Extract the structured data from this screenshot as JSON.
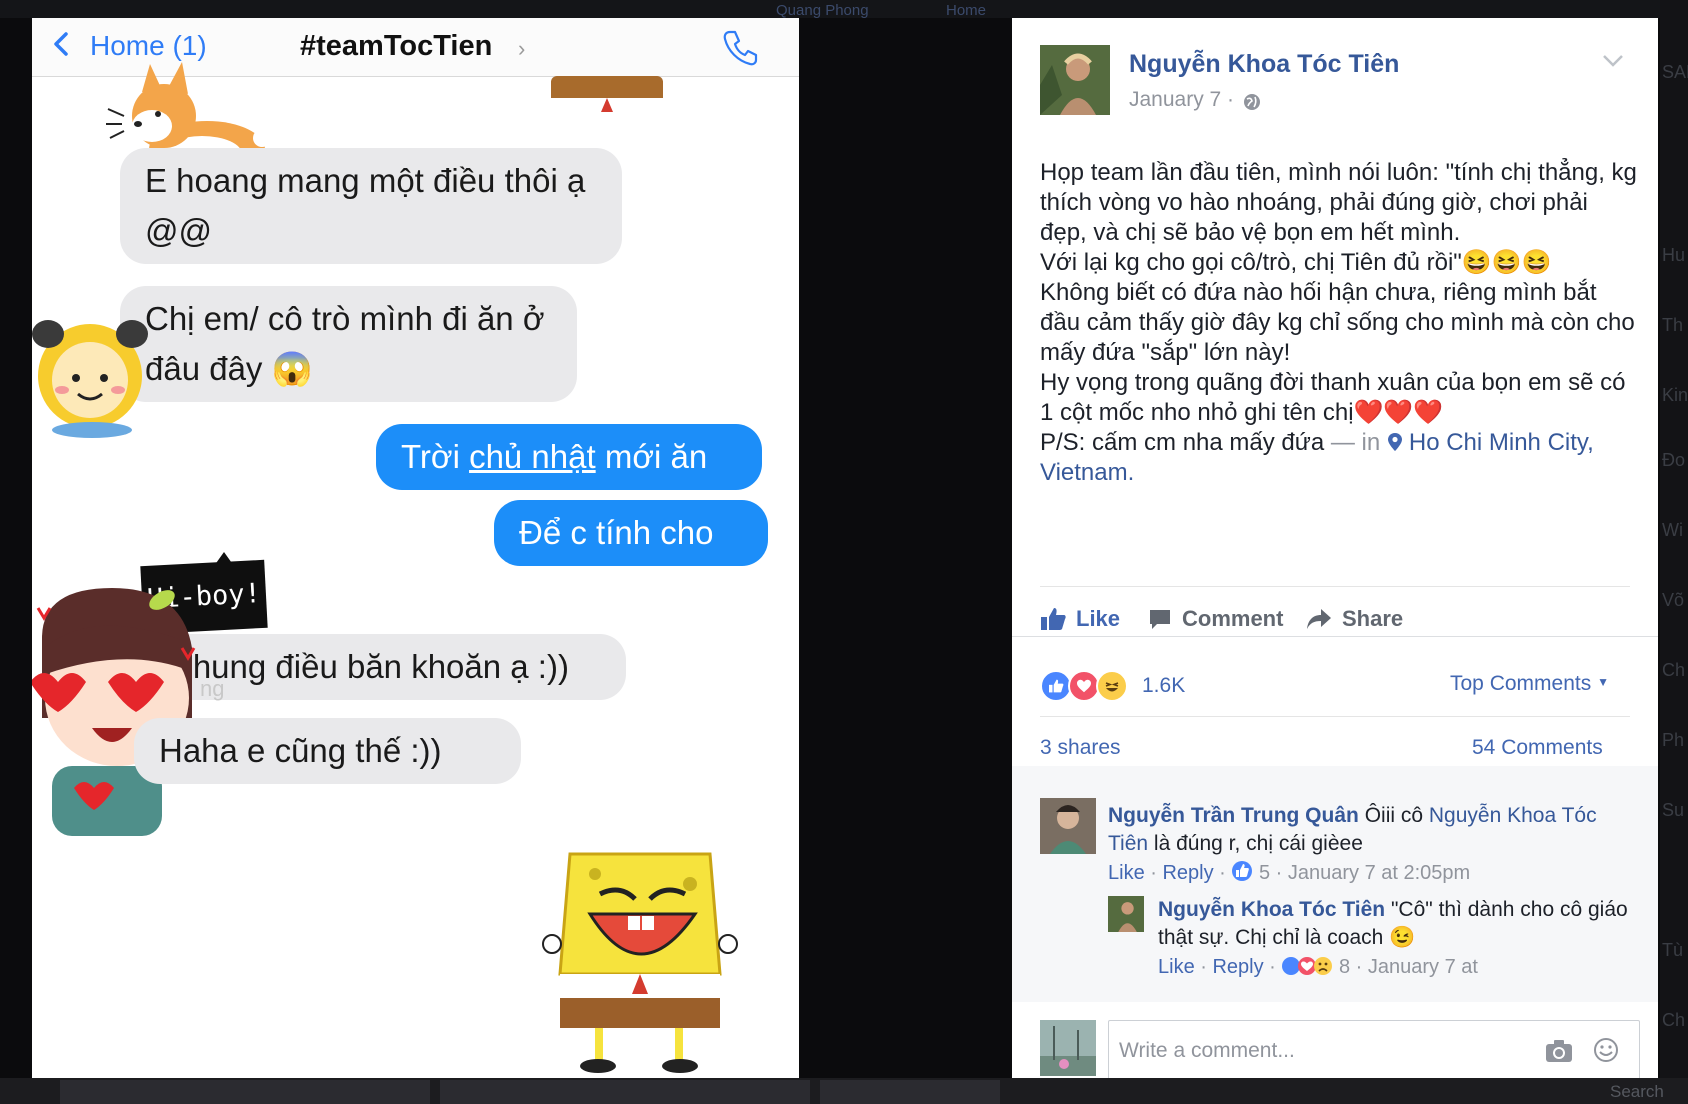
{
  "background": {
    "top_texts": [
      "Quang Phong",
      "Home"
    ],
    "right_side_fragments": [
      "SAM",
      "Hu",
      "Th",
      "Kin",
      "Đo",
      "Wi",
      "Võ",
      "Ch",
      "Ph",
      "Su",
      "Tù",
      "Ch"
    ],
    "bottom_search": "Search"
  },
  "chat": {
    "nav": {
      "back_label": "Home (1)",
      "title": "#teamTocTien",
      "title_chevron": "›"
    },
    "faded_label": "ng",
    "sticker_text": "Hi-boy!",
    "messages": [
      {
        "side": "received",
        "text": "E hoang mang một điều thôi ạ @@"
      },
      {
        "side": "received",
        "text_a": "Chị em/ cô trò mình đi ăn ở đâu đây ",
        "emoji": "😱"
      },
      {
        "side": "sent",
        "text_a": "Trời ",
        "text_link": "chủ nhật",
        "text_b": " mới ăn"
      },
      {
        "side": "sent",
        "text": "Để c tính cho"
      },
      {
        "side": "received",
        "text": "Chung điều băn khoăn ạ :))"
      },
      {
        "side": "received",
        "text": "Haha e cũng thế :))"
      }
    ]
  },
  "post": {
    "author": "Nguyễn Khoa Tóc Tiên",
    "date": "January 7 ·",
    "body_lines": [
      "Họp team lần đầu tiên, mình nói luôn: \"tính chị thẳng, kg thích vòng vo hào nhoáng, phải đúng giờ, chơi phải đẹp, và chị sẽ bảo vệ bọn em hết mình.",
      "Với lại kg cho gọi cô/trò, chị Tiên đủ rồi\"😆😆😆",
      "Không biết có đứa nào hối hận chưa, riêng mình bắt đầu cảm thấy giờ đây kg chỉ sống cho mình mà còn cho mấy đứa \"sắp\" lớn này!",
      "Hy vọng trong quãng đời thanh xuân của bọn em sẽ có 1 cột mốc nho nhỏ ghi tên chị❤️❤️❤️"
    ],
    "ps_text": "P/S: cấm cm nha mấy đứa",
    "ps_in": " — in ",
    "location": "Ho Chi Minh City, Vietnam",
    "location_end": ".",
    "actions": {
      "like": "Like",
      "comment": "Comment",
      "share": "Share"
    },
    "reaction_count": "1.6K",
    "top_comments": "Top Comments",
    "shares": "3 shares",
    "comments_count": "54 Comments",
    "comments": [
      {
        "name": "Nguyễn Trần Trung Quân",
        "text_a": " Ôiii cô ",
        "mention": "Nguyễn Khoa Tóc Tiên",
        "text_b": " là đúng r, chị cái gièee",
        "like": "Like",
        "reply": "Reply",
        "likes": "5",
        "time": "January 7 at 2:05pm"
      },
      {
        "name": "Nguyễn Khoa Tóc Tiên",
        "text_a": " \"Cô\" thì dành cho cô giáo thật sự. Chị chỉ là coach ",
        "emoji": "😉",
        "like": "Like",
        "reply": "Reply",
        "likes": "8",
        "time": "January 7 at"
      }
    ],
    "write_placeholder": "Write a comment...",
    "colors": {
      "link": "#365899",
      "like_blue": "#4267b2",
      "meta_gray": "#90949c",
      "imessage_blue": "#1c8ef9"
    }
  }
}
